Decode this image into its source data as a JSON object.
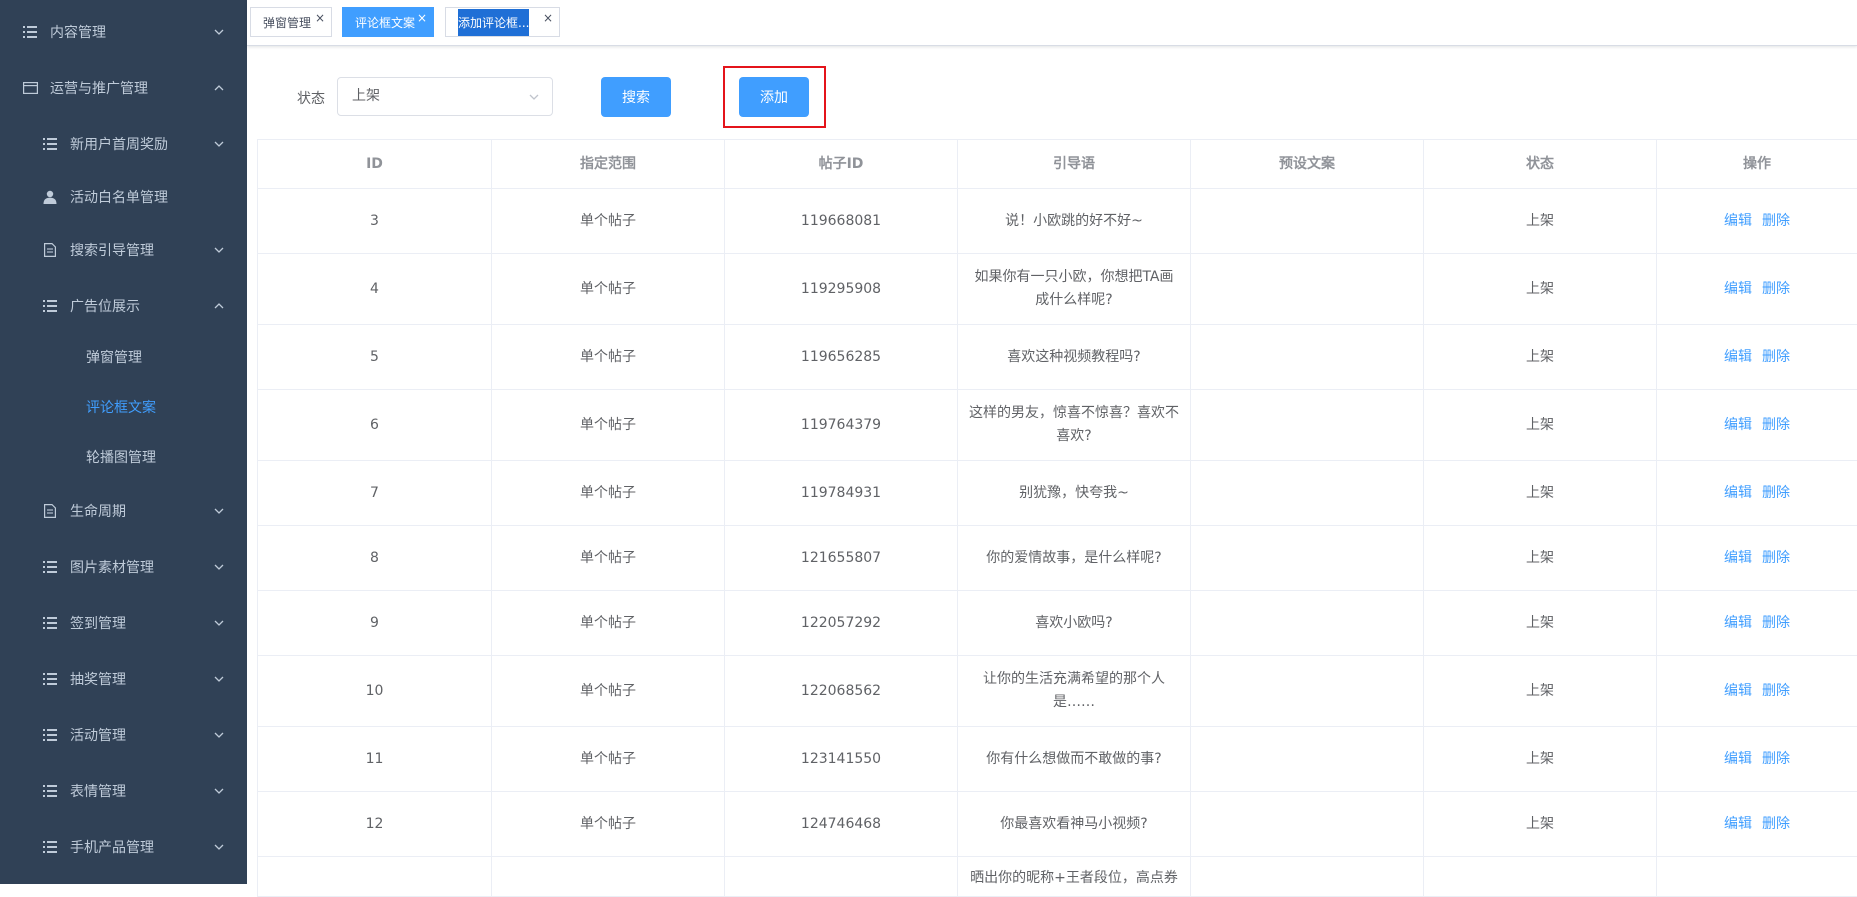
{
  "sidebar": {
    "items": [
      {
        "label": "内容管理",
        "icon": "list-icon"
      },
      {
        "label": "运营与推广管理",
        "icon": "window-icon"
      },
      {
        "label": "新用户首周奖励",
        "icon": "list-icon"
      },
      {
        "label": "活动白名单管理",
        "icon": "user-icon"
      },
      {
        "label": "搜索引导管理",
        "icon": "document-icon"
      },
      {
        "label": "广告位展示",
        "icon": "list-icon"
      },
      {
        "label": "弹窗管理"
      },
      {
        "label": "评论框文案"
      },
      {
        "label": "轮播图管理"
      },
      {
        "label": "生命周期",
        "icon": "document-icon"
      },
      {
        "label": "图片素材管理",
        "icon": "list-icon"
      },
      {
        "label": "签到管理",
        "icon": "list-icon"
      },
      {
        "label": "抽奖管理",
        "icon": "list-icon"
      },
      {
        "label": "活动管理",
        "icon": "list-icon"
      },
      {
        "label": "表情管理",
        "icon": "list-icon"
      },
      {
        "label": "手机产品管理",
        "icon": "list-icon"
      }
    ]
  },
  "tags": [
    {
      "label": "弹窗管理",
      "close": "×"
    },
    {
      "label": "评论框文案",
      "close": "×"
    },
    {
      "label": "添加评论框...",
      "close": "×"
    }
  ],
  "filter": {
    "status_label": "状态",
    "status_value": "上架",
    "search_label": "搜索",
    "add_label": "添加"
  },
  "table": {
    "headers": [
      "ID",
      "指定范围",
      "帖子ID",
      "引导语",
      "预设文案",
      "状态",
      "操作"
    ],
    "edit_label": "编辑",
    "delete_label": "删除",
    "rows": [
      {
        "id": "3",
        "scope": "单个帖子",
        "post_id": "119668081",
        "guide": "说！小欧跳的好不好~",
        "preset": "",
        "status": "上架"
      },
      {
        "id": "4",
        "scope": "单个帖子",
        "post_id": "119295908",
        "guide": "如果你有一只小欧，你想把TA画成什么样呢?",
        "preset": "",
        "status": "上架"
      },
      {
        "id": "5",
        "scope": "单个帖子",
        "post_id": "119656285",
        "guide": "喜欢这种视频教程吗?",
        "preset": "",
        "status": "上架"
      },
      {
        "id": "6",
        "scope": "单个帖子",
        "post_id": "119764379",
        "guide": "这样的男友，惊喜不惊喜？喜欢不喜欢?",
        "preset": "",
        "status": "上架"
      },
      {
        "id": "7",
        "scope": "单个帖子",
        "post_id": "119784931",
        "guide": "别犹豫，快夸我~",
        "preset": "",
        "status": "上架"
      },
      {
        "id": "8",
        "scope": "单个帖子",
        "post_id": "121655807",
        "guide": "你的爱情故事，是什么样呢?",
        "preset": "",
        "status": "上架"
      },
      {
        "id": "9",
        "scope": "单个帖子",
        "post_id": "122057292",
        "guide": "喜欢小欧吗?",
        "preset": "",
        "status": "上架"
      },
      {
        "id": "10",
        "scope": "单个帖子",
        "post_id": "122068562",
        "guide": "让你的生活充满希望的那个人是……",
        "preset": "",
        "status": "上架"
      },
      {
        "id": "11",
        "scope": "单个帖子",
        "post_id": "123141550",
        "guide": "你有什么想做而不敢做的事?",
        "preset": "",
        "status": "上架"
      },
      {
        "id": "12",
        "scope": "单个帖子",
        "post_id": "124746468",
        "guide": "你最喜欢看神马小视频?",
        "preset": "",
        "status": "上架"
      },
      {
        "id": "",
        "scope": "",
        "post_id": "",
        "guide": "晒出你的昵称+王者段位，高点券",
        "preset": "",
        "status": ""
      }
    ]
  },
  "colors": {
    "sidebar_bg": "#304156",
    "sidebar_text": "#bfcbd9",
    "accent": "#409eff",
    "highlight_border": "#e4141b"
  }
}
